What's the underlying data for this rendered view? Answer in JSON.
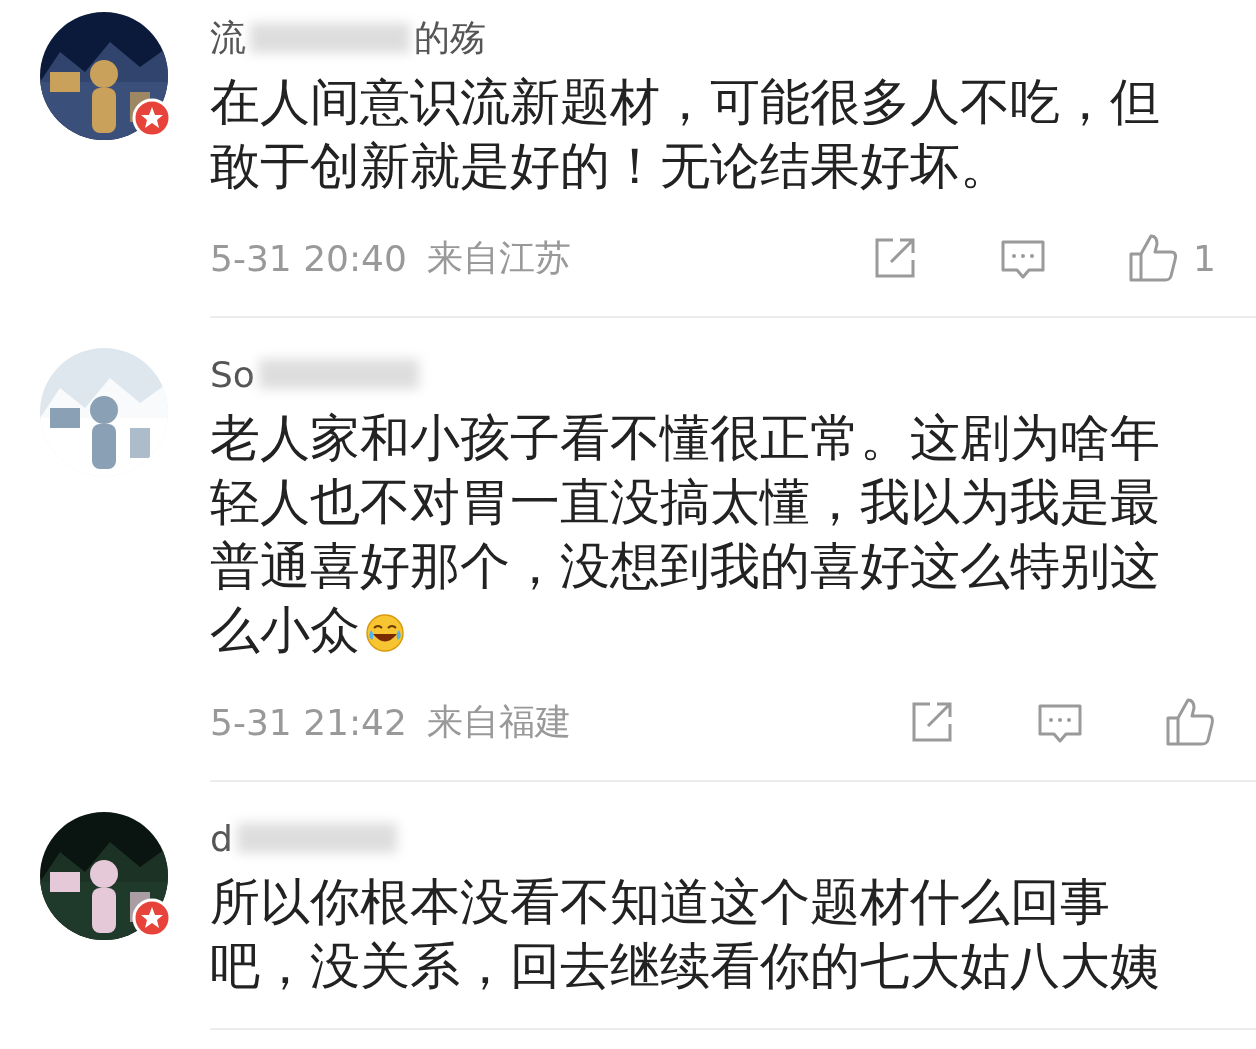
{
  "comments": [
    {
      "name_start": "流",
      "name_end": "的殇",
      "verified": true,
      "text": "在人间意识流新题材，可能很多人不吃，但敢于创新就是好的！无论结果好坏。",
      "time": "5-31 20:40",
      "location": "来自江苏",
      "likes": "1"
    },
    {
      "name_start": "So",
      "verified": false,
      "text": "老人家和小孩子看不懂很正常。这剧为啥年轻人也不对胃一直没搞太懂，我以为我是最普通喜好那个，没想到我的喜好这么特别这么小众",
      "laughing_emoji": true,
      "time": "5-31 21:42",
      "location": "来自福建"
    },
    {
      "name_start": "d",
      "verified": true,
      "text": "所以你根本没看不知道这个题材什么回事吧，没关系，回去继续看你的七大姑八大姨"
    }
  ]
}
